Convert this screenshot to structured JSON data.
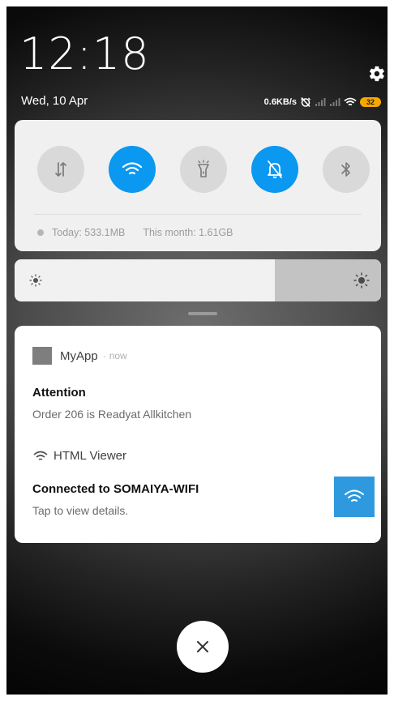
{
  "status": {
    "time": "12:18",
    "date": "Wed, 10 Apr",
    "net_speed": "0.6KB/s",
    "battery": "32"
  },
  "quick_settings": {
    "toggles": [
      {
        "icon": "data-transfer-icon",
        "active": false
      },
      {
        "icon": "wifi-icon",
        "active": true
      },
      {
        "icon": "flashlight-icon",
        "active": false
      },
      {
        "icon": "bell-off-icon",
        "active": true
      },
      {
        "icon": "bluetooth-icon",
        "active": false
      }
    ],
    "usage_today": "Today: 533.1MB",
    "usage_month": "This month: 1.61GB"
  },
  "brightness": {
    "level": 0.71
  },
  "notifications": {
    "myapp": {
      "app_name": "MyApp",
      "time": "now",
      "title": "Attention",
      "body": "Order 206 is Readyat Allkitchen"
    },
    "html_viewer": {
      "app_name": "HTML Viewer",
      "title": "Connected to SOMAIYA-WIFI",
      "body": "Tap to view details."
    }
  },
  "colors": {
    "accent": "#0a98f0",
    "wifi_tile": "#2f99e0",
    "battery": "#f6a800"
  }
}
